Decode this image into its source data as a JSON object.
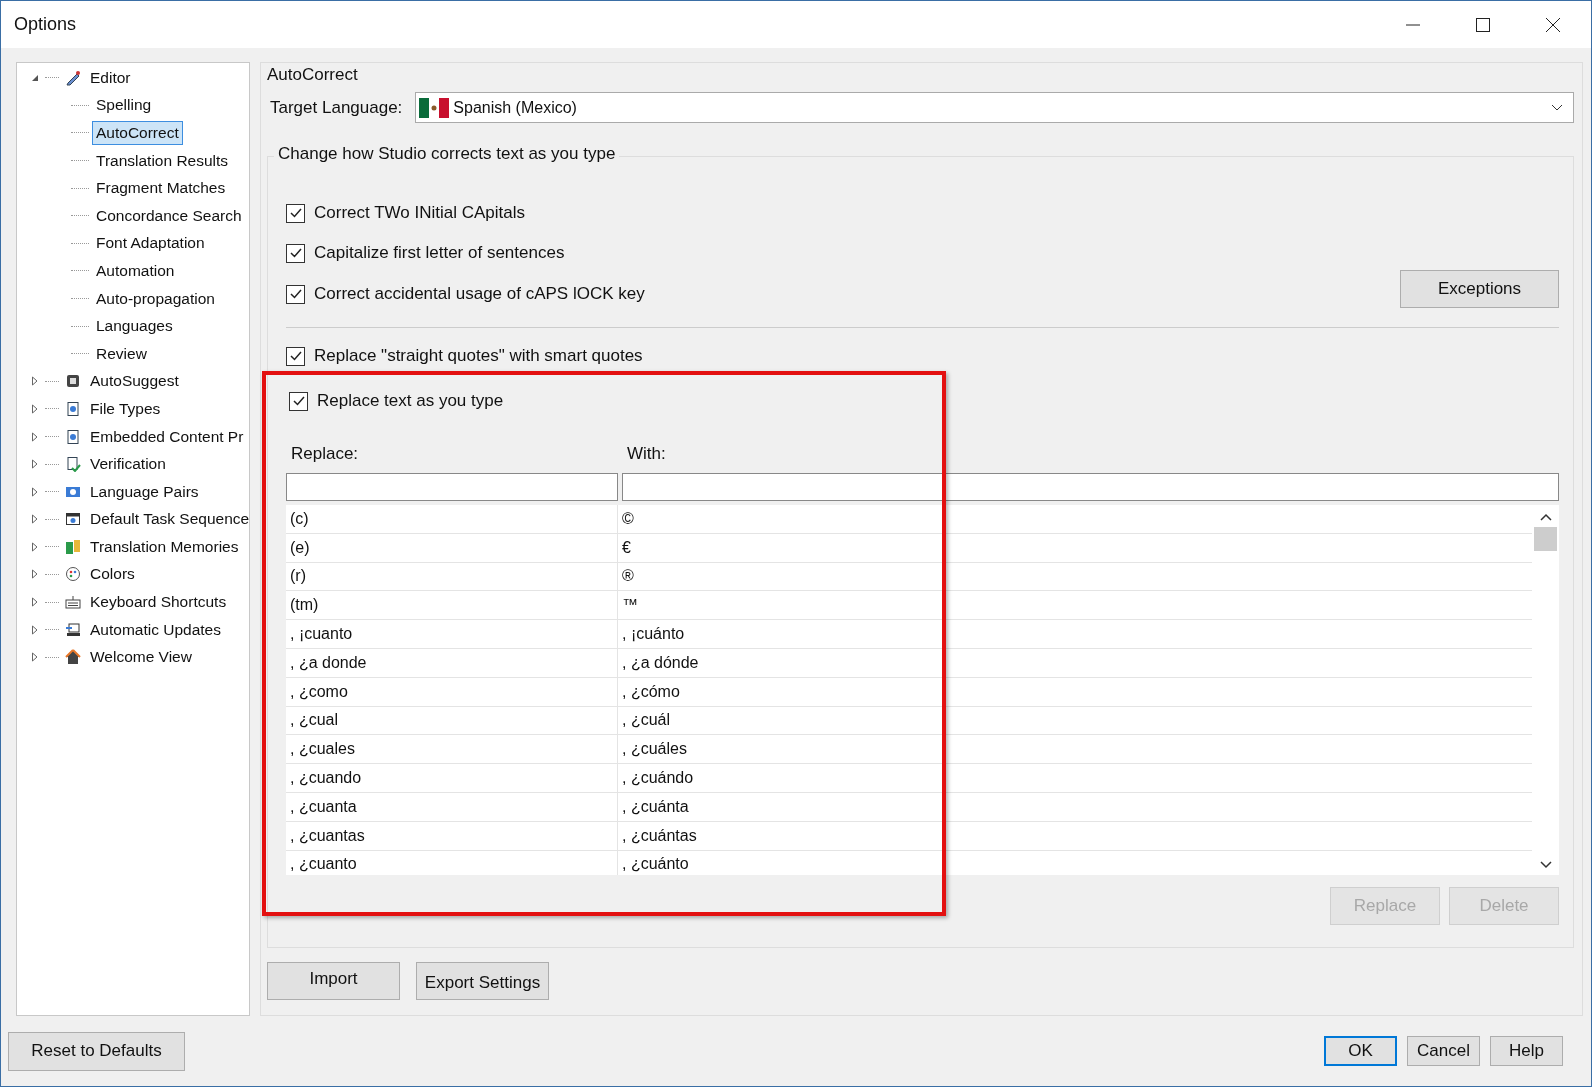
{
  "window": {
    "title": "Options"
  },
  "tree": [
    {
      "label": "Editor",
      "expanded": true,
      "selected": false,
      "children": [
        {
          "label": "Spelling",
          "selected": false
        },
        {
          "label": "AutoCorrect",
          "selected": true
        },
        {
          "label": "Translation Results",
          "selected": false
        },
        {
          "label": "Fragment Matches",
          "selected": false
        },
        {
          "label": "Concordance Search",
          "selected": false
        },
        {
          "label": "Font Adaptation",
          "selected": false
        },
        {
          "label": "Automation",
          "selected": false
        },
        {
          "label": "Auto-propagation",
          "selected": false
        },
        {
          "label": "Languages",
          "selected": false
        },
        {
          "label": "Review",
          "selected": false
        }
      ]
    },
    {
      "label": "AutoSuggest",
      "expanded": false,
      "selected": false
    },
    {
      "label": "File Types",
      "expanded": false,
      "selected": false
    },
    {
      "label": "Embedded Content Pr",
      "expanded": false,
      "selected": false
    },
    {
      "label": "Verification",
      "expanded": false,
      "selected": false
    },
    {
      "label": "Language Pairs",
      "expanded": false,
      "selected": false
    },
    {
      "label": "Default Task Sequence",
      "expanded": false,
      "selected": false
    },
    {
      "label": "Translation Memories",
      "expanded": false,
      "selected": false
    },
    {
      "label": "Colors",
      "expanded": false,
      "selected": false
    },
    {
      "label": "Keyboard Shortcuts",
      "expanded": false,
      "selected": false
    },
    {
      "label": "Automatic Updates",
      "expanded": false,
      "selected": false
    },
    {
      "label": "Welcome View",
      "expanded": false,
      "selected": false
    }
  ],
  "panel": {
    "title": "AutoCorrect",
    "target_language_label": "Target Language:",
    "target_language": "Spanish (Mexico)",
    "group_title": "Change how Studio corrects text as you type",
    "options": [
      {
        "label": "Correct TWo INitial CApitals",
        "checked": true
      },
      {
        "label": "Capitalize first letter of sentences",
        "checked": true
      },
      {
        "label": "Correct accidental usage of cAPS lOCK key",
        "checked": true
      },
      {
        "label": "Replace \"straight quotes\" with smart quotes",
        "checked": true
      },
      {
        "label": "Replace text as you type",
        "checked": true
      }
    ],
    "exceptions_button": "Exceptions",
    "replace_label": "Replace:",
    "with_label": "With:",
    "rows": [
      {
        "replace": "(c)",
        "with": "©"
      },
      {
        "replace": "(e)",
        "with": "€"
      },
      {
        "replace": "(r)",
        "with": "®"
      },
      {
        "replace": "(tm)",
        "with": "™"
      },
      {
        "replace": ", ¡cuanto",
        "with": ", ¡cuánto"
      },
      {
        "replace": ", ¿a donde",
        "with": ", ¿a dónde"
      },
      {
        "replace": ", ¿como",
        "with": ", ¿cómo"
      },
      {
        "replace": ", ¿cual",
        "with": ", ¿cuál"
      },
      {
        "replace": ", ¿cuales",
        "with": ", ¿cuáles"
      },
      {
        "replace": ", ¿cuando",
        "with": ", ¿cuándo"
      },
      {
        "replace": ", ¿cuanta",
        "with": ", ¿cuánta"
      },
      {
        "replace": ", ¿cuantas",
        "with": ", ¿cuántas"
      },
      {
        "replace": ", ¿cuanto",
        "with": ", ¿cuánto"
      }
    ],
    "table_buttons": [
      {
        "label": "Replace",
        "disabled": true
      },
      {
        "label": "Delete",
        "disabled": true
      }
    ]
  },
  "panel_buttons": [
    "Import",
    "Export Settings"
  ],
  "reset_button": "Reset to Defaults",
  "dialog_buttons": [
    {
      "label": "OK",
      "default": true
    },
    {
      "label": "Cancel",
      "default": false
    },
    {
      "label": "Help",
      "default": false
    }
  ]
}
